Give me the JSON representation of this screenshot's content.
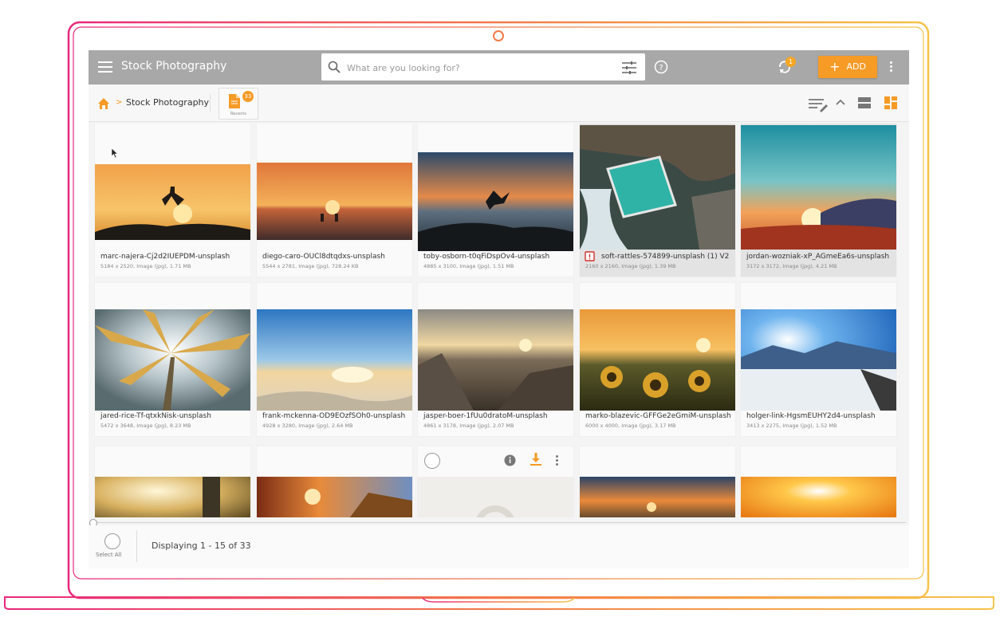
{
  "app": {
    "title": "Stock Photography"
  },
  "search": {
    "placeholder": "What are you looking for?"
  },
  "header": {
    "sync_count": "1",
    "add_label": "ADD"
  },
  "breadcrumb": {
    "label": "Stock Photography",
    "separator": ">"
  },
  "recent": {
    "count": "33",
    "label": "Recents"
  },
  "colors": {
    "accent": "#f59b26",
    "topbar": "#a8a8a8"
  },
  "icons": [
    "hamburger-icon",
    "search-icon",
    "filter-icon",
    "help-icon",
    "sync-icon",
    "plus-icon",
    "kebab-icon",
    "home-icon",
    "document-icon",
    "sort-icon",
    "chevron-up-icon",
    "list-view-icon",
    "grid-view-icon",
    "info-icon",
    "download-icon",
    "warning-icon",
    "cursor-icon"
  ],
  "assets": [
    {
      "name": "marc-najera-Cj2d2IUEPDM-unsplash",
      "meta": "5184 x 2520, Image (jpg), 1.71 MB"
    },
    {
      "name": "diego-caro-OUCl8dtqdxs-unsplash",
      "meta": "5544 x 2781, Image (jpg), 728.24 KB"
    },
    {
      "name": "toby-osborn-t0qFiDspOv4-unsplash",
      "meta": "4885 x 3100, Image (jpg), 1.51 MB"
    },
    {
      "name": "soft-rattles-574899-unsplash (1) V2",
      "meta": "2160 x 2160, Image (jpg), 1.39 MB"
    },
    {
      "name": "jordan-wozniak-xP_AGmeEa6s-unsplash",
      "meta": "3172 x 3172, Image (jpg), 4.21 MB"
    },
    {
      "name": "jared-rice-Tf-qtxkNisk-unsplash",
      "meta": "5472 x 3648, Image (jpg), 8.23 MB"
    },
    {
      "name": "frank-mckenna-OD9EOzfSOh0-unsplash",
      "meta": "4928 x 3280, Image (jpg), 2.64 MB"
    },
    {
      "name": "jasper-boer-1fUu0dratoM-unsplash",
      "meta": "4861 x 3178, Image (jpg), 2.07 MB"
    },
    {
      "name": "marko-blazevic-GFFGe2eGmiM-unsplash",
      "meta": "6000 x 4000, Image (jpg), 3.17 MB"
    },
    {
      "name": "holger-link-HgsmEUHY2d4-unsplash",
      "meta": "3413 x 2275, Image (jpg), 1.52 MB"
    }
  ],
  "footer": {
    "select_all": "Select All",
    "displaying": "Displaying 1 - 15 of 33"
  }
}
